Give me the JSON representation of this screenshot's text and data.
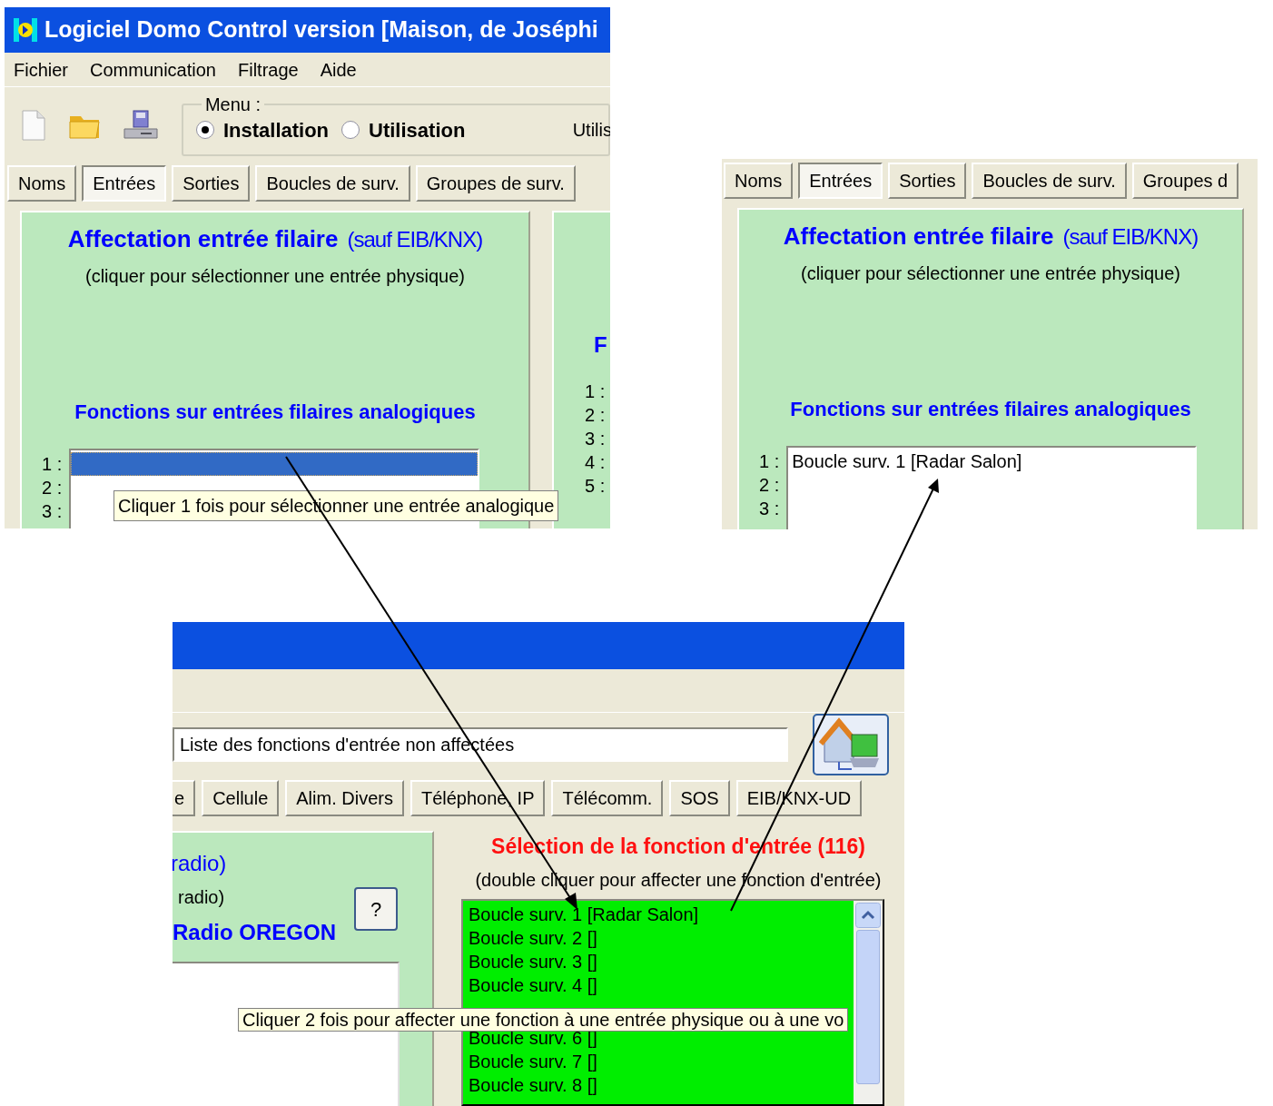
{
  "installation_window": {
    "title": "Logiciel Domo Control version  [Maison, de Joséphi",
    "menu": [
      "Fichier",
      "Communication",
      "Filtrage",
      "Aide"
    ],
    "mode_group": {
      "label": "Menu :",
      "options": [
        {
          "label": "Installation",
          "selected": true
        },
        {
          "label": "Utilisation",
          "selected": false
        }
      ]
    },
    "user_label": "Utilis",
    "tabs": [
      {
        "label": "Noms",
        "selected": false
      },
      {
        "label": "Entrées",
        "selected": true
      },
      {
        "label": "Sorties",
        "selected": false
      },
      {
        "label": "Boucles de surv.",
        "selected": false
      },
      {
        "label": "Groupes de surv.",
        "selected": false
      }
    ],
    "panel": {
      "title": "Affectation entrée filaire",
      "title_note": "(sauf EIB/KNX)",
      "hint": "(cliquer pour sélectionner une entrée physique)",
      "section_title": "Fonctions sur entrées filaires analogiques",
      "slots": [
        {
          "number": "1 :",
          "selected": true
        },
        {
          "number": "2 :",
          "selected": false
        },
        {
          "number": "3 :",
          "selected": false
        }
      ]
    },
    "side_panel": {
      "title": "F",
      "numbers": [
        "1 :",
        "2 :",
        "3 :",
        "4 :",
        "5 :"
      ]
    },
    "tooltip": "Cliquer 1 fois pour sélectionner une entrée analogique"
  },
  "result_view": {
    "tabs": [
      {
        "label": "Noms",
        "selected": false
      },
      {
        "label": "Entrées",
        "selected": true
      },
      {
        "label": "Sorties",
        "selected": false
      },
      {
        "label": "Boucles de surv.",
        "selected": false
      },
      {
        "label": "Groupes d",
        "selected": false
      }
    ],
    "panel": {
      "title": "Affectation entrée filaire",
      "title_note": "(sauf EIB/KNX)",
      "hint": "(cliquer pour sélectionner une entrée physique)",
      "section_title": "Fonctions sur entrées filaires analogiques",
      "slots": [
        {
          "number": "1 :",
          "value": "Boucle surv. 1 [Radar Salon]",
          "selected": false
        },
        {
          "number": "2 :",
          "selected": false
        },
        {
          "number": "3 :",
          "selected": false
        }
      ]
    }
  },
  "function_list_window": {
    "filter_field": {
      "value": "Liste des fonctions d'entrée non affectées"
    },
    "tabs": [
      "e",
      "Cellule",
      "Alim. Divers",
      "Téléphone, IP",
      "Télécomm.",
      "SOS",
      "EIB/KNX-UD"
    ],
    "radio_panel": {
      "title_fragment": "radio)",
      "note_fragment": "radio)",
      "device": "Radio OREGON",
      "help_button": "?"
    },
    "selection": {
      "title": "Sélection de la fonction d'entrée (116)",
      "hint": "(double cliquer pour affecter une fonction d'entrée)",
      "items_above": [
        "Boucle surv. 1 [Radar Salon]",
        "Boucle surv. 2 []",
        "Boucle surv. 3 []",
        "Boucle surv. 4 []"
      ],
      "items_below": [
        "Boucle surv. 6 []",
        "Boucle surv. 7 []",
        "Boucle surv. 8 []"
      ]
    },
    "tooltip": "Cliquer 2 fois pour affecter une fonction à une entrée physique ou à une vo"
  }
}
